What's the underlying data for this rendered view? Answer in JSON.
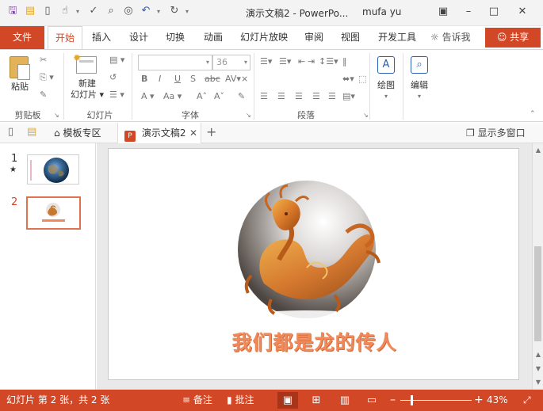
{
  "app": {
    "window_title": "演示文稿2 - PowerPo...",
    "user": "mufa yu"
  },
  "tabs": {
    "file": "文件",
    "items": [
      "开始",
      "插入",
      "设计",
      "切换",
      "动画",
      "幻灯片放映",
      "审阅",
      "视图",
      "开发工具"
    ],
    "active": "开始",
    "tell_me": "告诉我",
    "share": "共享"
  },
  "ribbon": {
    "clipboard": {
      "paste": "粘贴",
      "label": "剪贴板"
    },
    "slides": {
      "new_slide_line1": "新建",
      "new_slide_line2": "幻灯片",
      "label": "幻灯片"
    },
    "font": {
      "font_name": "",
      "font_size": "36",
      "label": "字体"
    },
    "paragraph": {
      "label": "段落"
    },
    "drawing": {
      "label": "绘图"
    },
    "editing": {
      "label": "编辑"
    }
  },
  "doc_tabs": {
    "template": "模板专区",
    "current": "演示文稿2",
    "multi_window": "显示多窗口"
  },
  "thumbnails": [
    {
      "number": "1",
      "star": "★",
      "selected": false
    },
    {
      "number": "2",
      "star": "",
      "selected": true
    }
  ],
  "slide": {
    "title": "我们都是龙的传人"
  },
  "status": {
    "slide_info": "幻灯片 第 2 张，共 2 张",
    "notes": "备注",
    "comments": "批注",
    "zoom": "43%"
  },
  "colors": {
    "accent": "#d24726",
    "title_text": "#f08a5a"
  }
}
